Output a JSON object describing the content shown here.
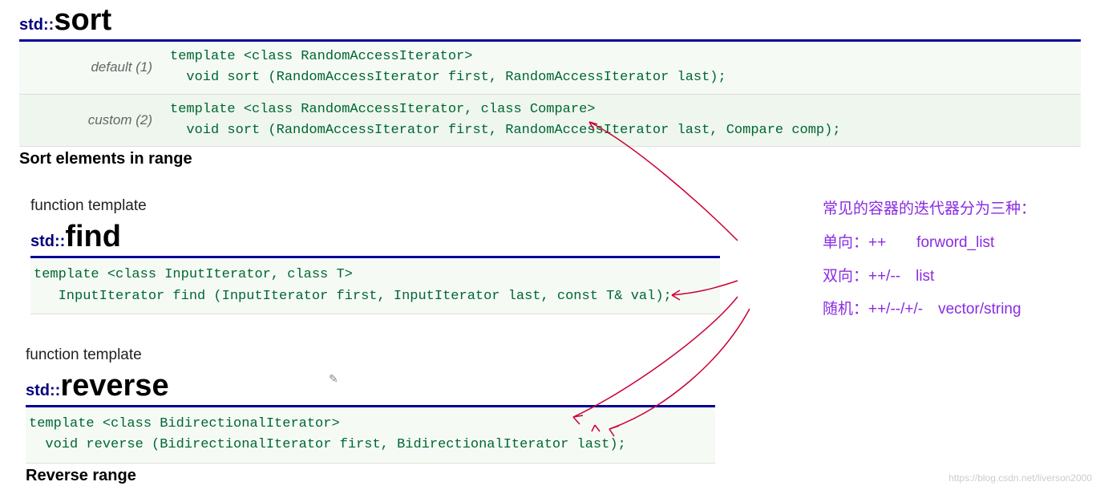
{
  "sort": {
    "ns": "std::",
    "name": "sort",
    "rows": [
      {
        "label": "default (1)",
        "code": "template <class RandomAccessIterator>\n  void sort (RandomAccessIterator first, RandomAccessIterator last);"
      },
      {
        "label": "custom (2)",
        "code": "template <class RandomAccessIterator, class Compare>\n  void sort (RandomAccessIterator first, RandomAccessIterator last, Compare comp);"
      }
    ],
    "section": "Sort elements in range"
  },
  "find": {
    "ft": "function template",
    "ns": "std::",
    "name": "find",
    "sig": "template <class InputIterator, class T>\n   InputIterator find (InputIterator first, InputIterator last, const T& val);"
  },
  "reverse": {
    "ft": "function template",
    "ns": "std::",
    "name": "reverse",
    "sig": "template <class BidirectionalIterator>\n  void reverse (BidirectionalIterator first, BidirectionalIterator last);",
    "section": "Reverse range"
  },
  "annot": {
    "title": "常见的容器的迭代器分为三种：",
    "r1": "单向：++  forword_list",
    "r2": "双向：++/-- list",
    "r3": "随机：++/--/+/- vector/string"
  },
  "watermark": "https://blog.csdn.net/liverson2000"
}
